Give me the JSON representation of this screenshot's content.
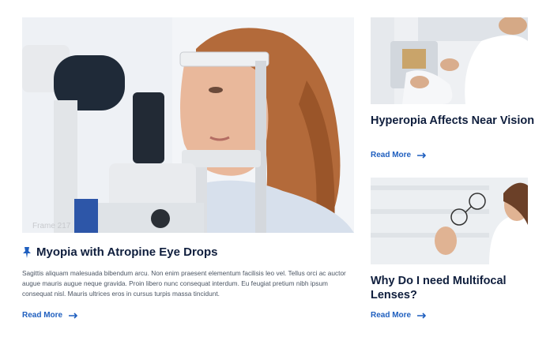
{
  "main_article": {
    "frame_label": "Frame 217",
    "title": "Myopia with Atropine Eye Drops",
    "body": "Sagittis aliquam malesuada bibendum arcu. Non enim praesent elementum facilisis leo vel. Tellus orci ac auctor augue mauris augue neque gravida. Proin libero nunc consequat interdum. Eu feugiat pretium nibh ipsum consequat nisl. Mauris ultrices eros in cursus turpis massa tincidunt.",
    "read_more": "Read More",
    "icon": "pin-icon"
  },
  "side_articles": [
    {
      "title": "Hyperopia Affects Near Vision",
      "read_more": "Read More"
    },
    {
      "title": "Why Do I need Multifocal Lenses?",
      "read_more": "Read More"
    }
  ],
  "colors": {
    "title": "#0f1e3d",
    "link": "#1f5fbf",
    "body_text": "#4b5563"
  }
}
